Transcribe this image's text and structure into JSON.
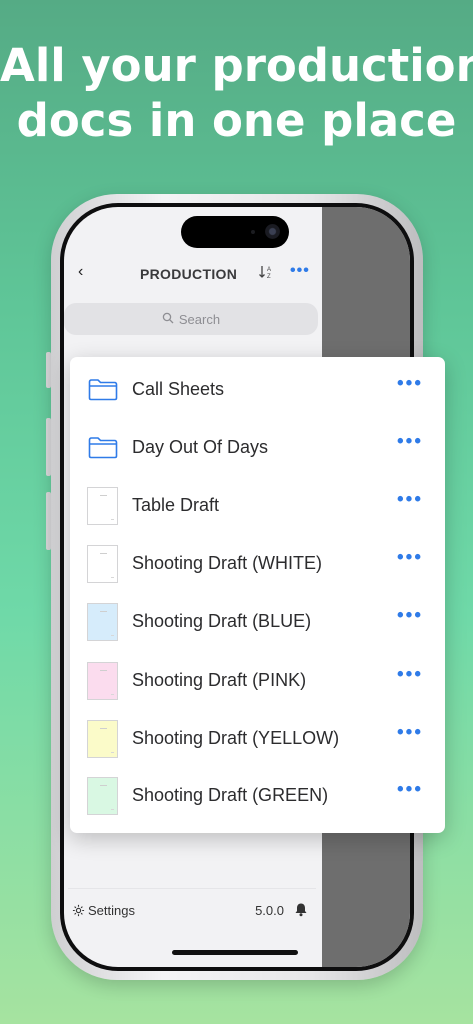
{
  "headline": {
    "line1": "All your production",
    "line2": "docs in one place"
  },
  "app": {
    "nav": {
      "back_glyph": "‹",
      "title": "PRODUCTION",
      "sort_icon": "sort-az-icon",
      "sort_glyph": "↓ᴬz",
      "more_glyph": "•••"
    },
    "search": {
      "icon": "🔍",
      "placeholder": "Search"
    },
    "footer": {
      "settings_label": "Settings",
      "version": "5.0.0"
    }
  },
  "files": [
    {
      "label": "Call Sheets",
      "kind": "folder",
      "color": "#ffffff"
    },
    {
      "label": "Day Out Of Days",
      "kind": "folder",
      "color": "#ffffff"
    },
    {
      "label": "Table Draft",
      "kind": "doc",
      "color": "#ffffff"
    },
    {
      "label": "Shooting Draft (WHITE)",
      "kind": "doc",
      "color": "#ffffff"
    },
    {
      "label": "Shooting Draft (BLUE)",
      "kind": "doc",
      "color": "#d6ecfb"
    },
    {
      "label": "Shooting Draft (PINK)",
      "kind": "doc",
      "color": "#fbdcee"
    },
    {
      "label": "Shooting Draft (YELLOW)",
      "kind": "doc",
      "color": "#fbfbc9"
    },
    {
      "label": "Shooting Draft (GREEN)",
      "kind": "doc",
      "color": "#d9f8e3"
    }
  ],
  "more_glyph": "•••",
  "colors": {
    "accent": "#2f7be8",
    "background_top": "#55ab85",
    "background_bottom": "#a6e3a0"
  }
}
